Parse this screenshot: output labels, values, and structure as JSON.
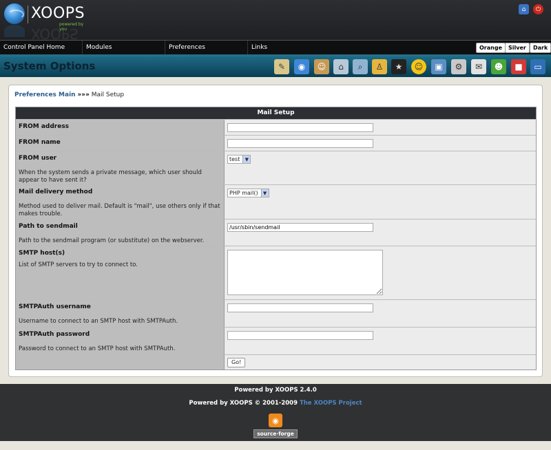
{
  "header": {
    "logo_name": "XOOPS",
    "logo_tagline": "powered by you",
    "home_icon": "home-icon",
    "logout_icon": "power-icon"
  },
  "nav": {
    "items": [
      "Control Panel Home",
      "Modules",
      "Preferences",
      "Links"
    ],
    "themes": [
      "Orange",
      "Silver",
      "Dark"
    ]
  },
  "toolbar": {
    "title": "System Options",
    "icons": [
      "notepad-icon",
      "globe-icon",
      "users-icon",
      "house-icon",
      "search-icon",
      "person-icon",
      "star-icon",
      "smiley-icon",
      "monitor-icon",
      "gears-icon",
      "mail-icon",
      "group-icon",
      "blocks-icon",
      "screen-icon"
    ]
  },
  "breadcrumb": {
    "link": "Preferences Main",
    "separator": "»»»",
    "current": "Mail Setup"
  },
  "form": {
    "heading": "Mail Setup",
    "from_address": {
      "label": "FROM address",
      "value": ""
    },
    "from_name": {
      "label": "FROM name",
      "value": ""
    },
    "from_user": {
      "label": "FROM user",
      "desc": "When the system sends a private message, which user should appear to have sent it?",
      "selected": "test"
    },
    "mail_method": {
      "label": "Mail delivery method",
      "desc": "Method used to deliver mail. Default is \"mail\", use others only if that makes trouble.",
      "selected": "PHP mail()"
    },
    "sendmail_path": {
      "label": "Path to sendmail",
      "desc": "Path to the sendmail program (or substitute) on the webserver.",
      "value": "/usr/sbin/sendmail"
    },
    "smtp_hosts": {
      "label": "SMTP host(s)",
      "desc": "List of SMTP servers to try to connect to.",
      "value": ""
    },
    "smtp_user": {
      "label": "SMTPAuth username",
      "desc": "Username to connect to an SMTP host with SMTPAuth.",
      "value": ""
    },
    "smtp_pass": {
      "label": "SMTPAuth password",
      "desc": "Password to connect to an SMTP host with SMTPAuth.",
      "value": ""
    },
    "submit_label": "Go!"
  },
  "footer": {
    "line1": "Powered by XOOPS 2.4.0",
    "line2_prefix": "Powered by XOOPS © 2001-2009",
    "line2_link": "The XOOPS Project",
    "badge": "source·forge"
  },
  "colors": {
    "header_bg": "#1e2023",
    "toolbar_bg": "#0a3e55",
    "table_head": "#2b2e33",
    "link": "#2b5c8a"
  }
}
